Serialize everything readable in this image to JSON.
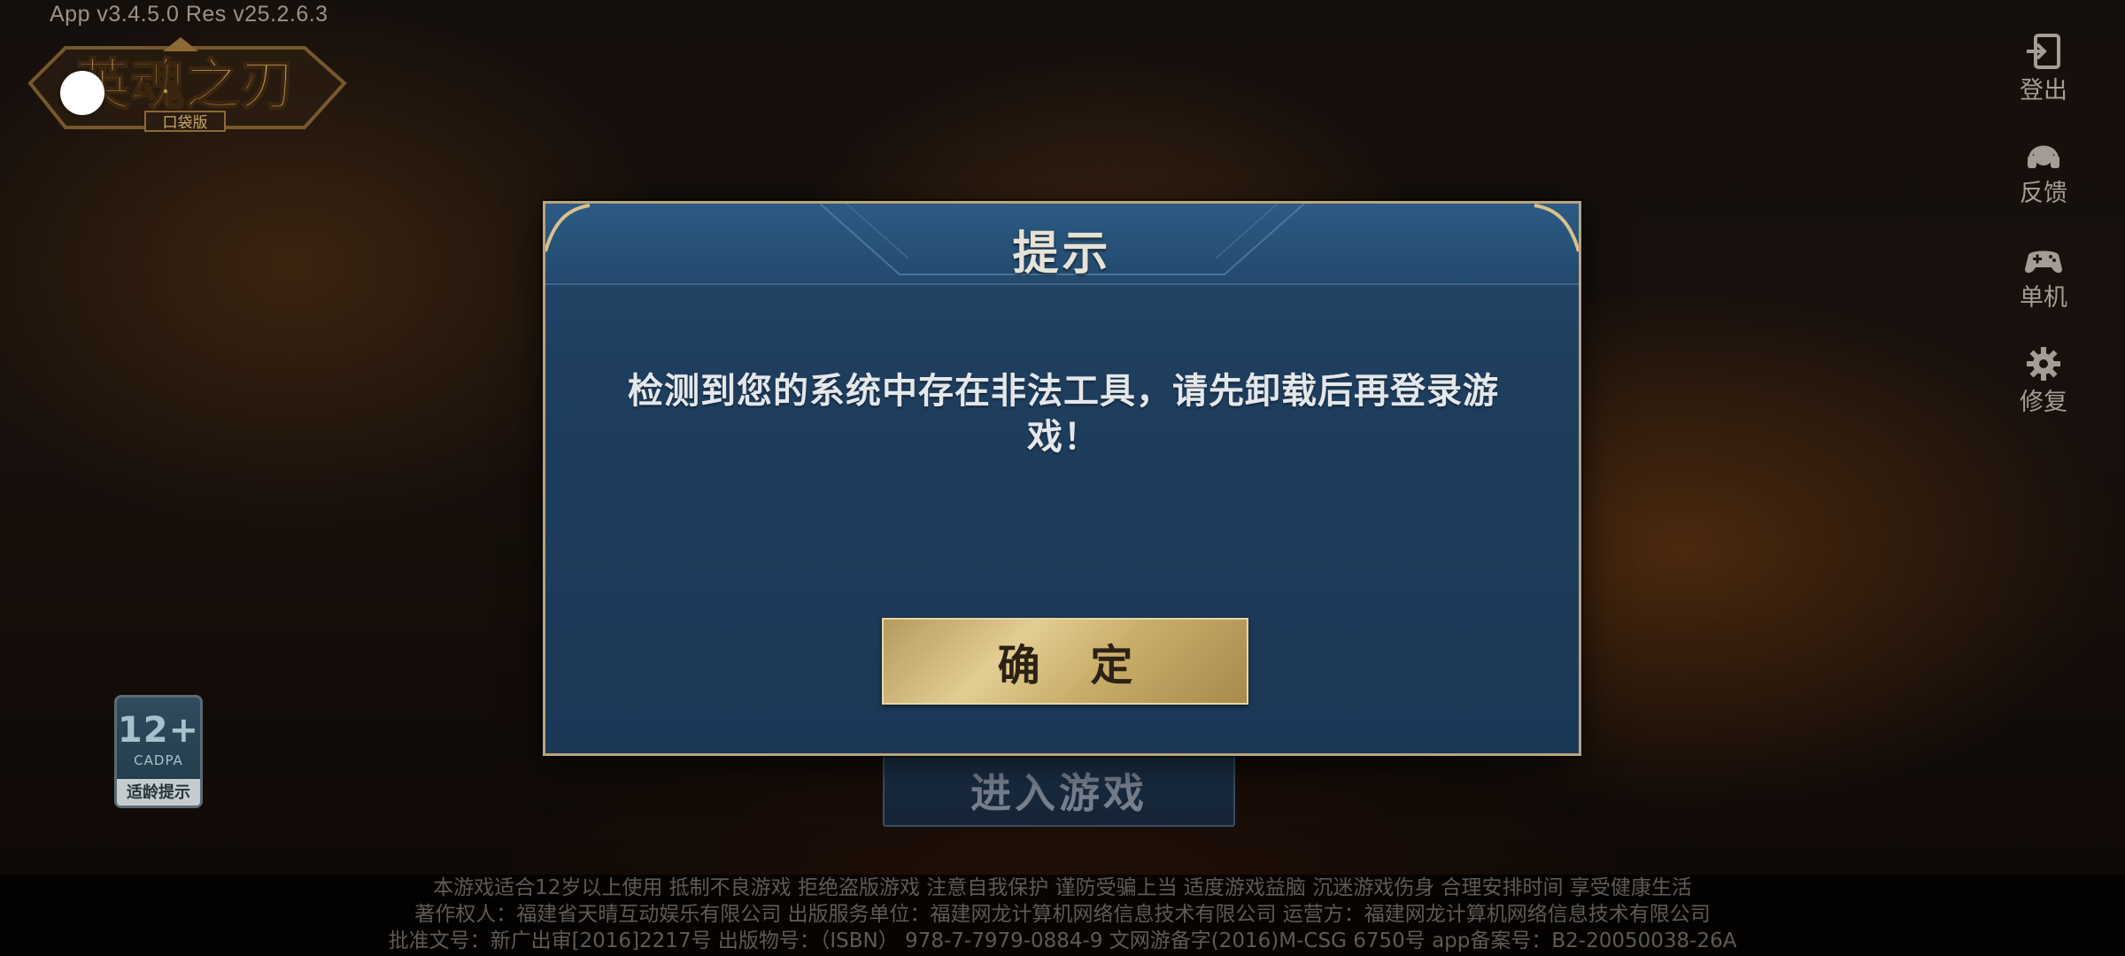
{
  "app": {
    "version_text": "App v3.4.5.0   Res v25.2.6.3",
    "logo_text": "英魂之刃",
    "logo_subtext": "口袋版"
  },
  "side_menu": [
    {
      "label": "登出",
      "icon": "logout-icon"
    },
    {
      "label": "反馈",
      "icon": "headset-icon"
    },
    {
      "label": "单机",
      "icon": "gamepad-icon"
    },
    {
      "label": "修复",
      "icon": "gear-icon"
    }
  ],
  "age_badge": {
    "age": "12+",
    "org": "CADPA",
    "tip": "适龄提示"
  },
  "enter_button": "进入游戏",
  "dialog": {
    "title": "提示",
    "message": "检测到您的系统中存在非法工具，请先卸载后再登录游戏！",
    "confirm_label": "确 定"
  },
  "footer": {
    "line1": "本游戏适合12岁以上使用 抵制不良游戏 拒绝盗版游戏 注意自我保护 谨防受骗上当 适度游戏益脑 沉迷游戏伤身 合理安排时间 享受健康生活",
    "line2": "著作权人：福建省天晴互动娱乐有限公司 出版服务单位：福建网龙计算机网络信息技术有限公司 运营方：福建网龙计算机网络信息技术有限公司",
    "line3": "批准文号：新广出审[2016]2217号 出版物号：（ISBN） 978-7-7979-0884-9 文网游备字(2016)M-CSG 6750号 app备案号：B2-20050038-26A"
  },
  "colors": {
    "dialog_bg": "#1f3e5e",
    "dialog_border": "#b9a47c",
    "confirm_gold": "#e2cd92"
  }
}
